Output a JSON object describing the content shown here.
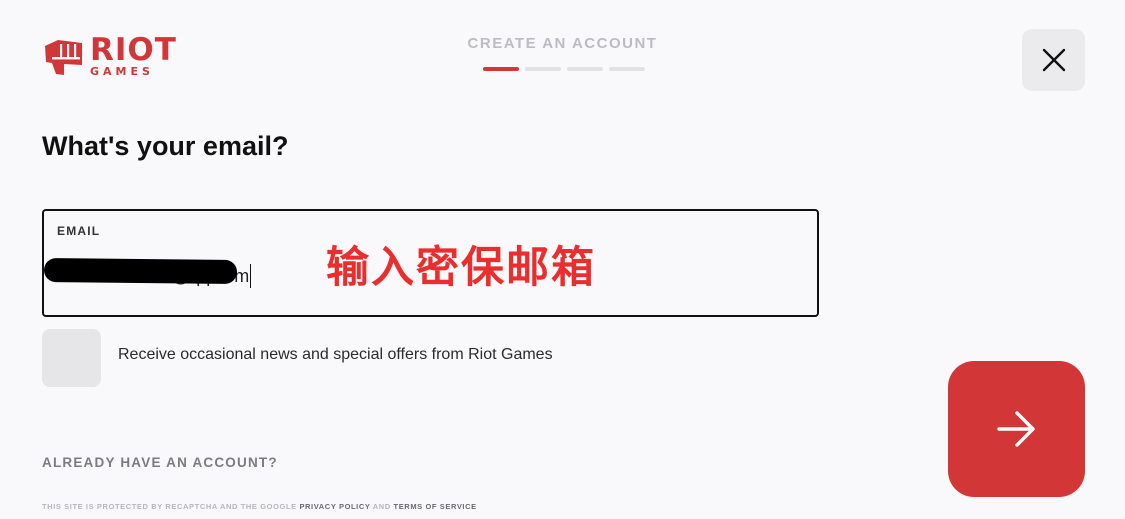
{
  "brand": {
    "name_line1": "RIOT",
    "name_line2": "GAMES",
    "accent_color": "#d13639",
    "logo_icon": "riot-fist-icon"
  },
  "header": {
    "step_title": "CREATE AN ACCOUNT",
    "progress": {
      "current_step": 1,
      "total_steps": 4
    }
  },
  "close_button": {
    "icon": "close-icon"
  },
  "form": {
    "heading": "What's your email?",
    "email_label": "EMAIL",
    "email_visible_suffix": "@qq.com",
    "annotation": "输入密保邮箱"
  },
  "newsletter": {
    "checked": false,
    "label": "Receive occasional news and special offers from Riot Games"
  },
  "links": {
    "already_have_account": "ALREADY HAVE AN ACCOUNT?"
  },
  "footer": {
    "prefix": "THIS SITE IS PROTECTED BY RECAPTCHA AND THE GOOGLE",
    "privacy_policy": "PRIVACY POLICY",
    "and": "AND",
    "terms": "TERMS OF SERVICE"
  },
  "next_button": {
    "icon": "arrow-right-icon",
    "color": "#d23637"
  }
}
